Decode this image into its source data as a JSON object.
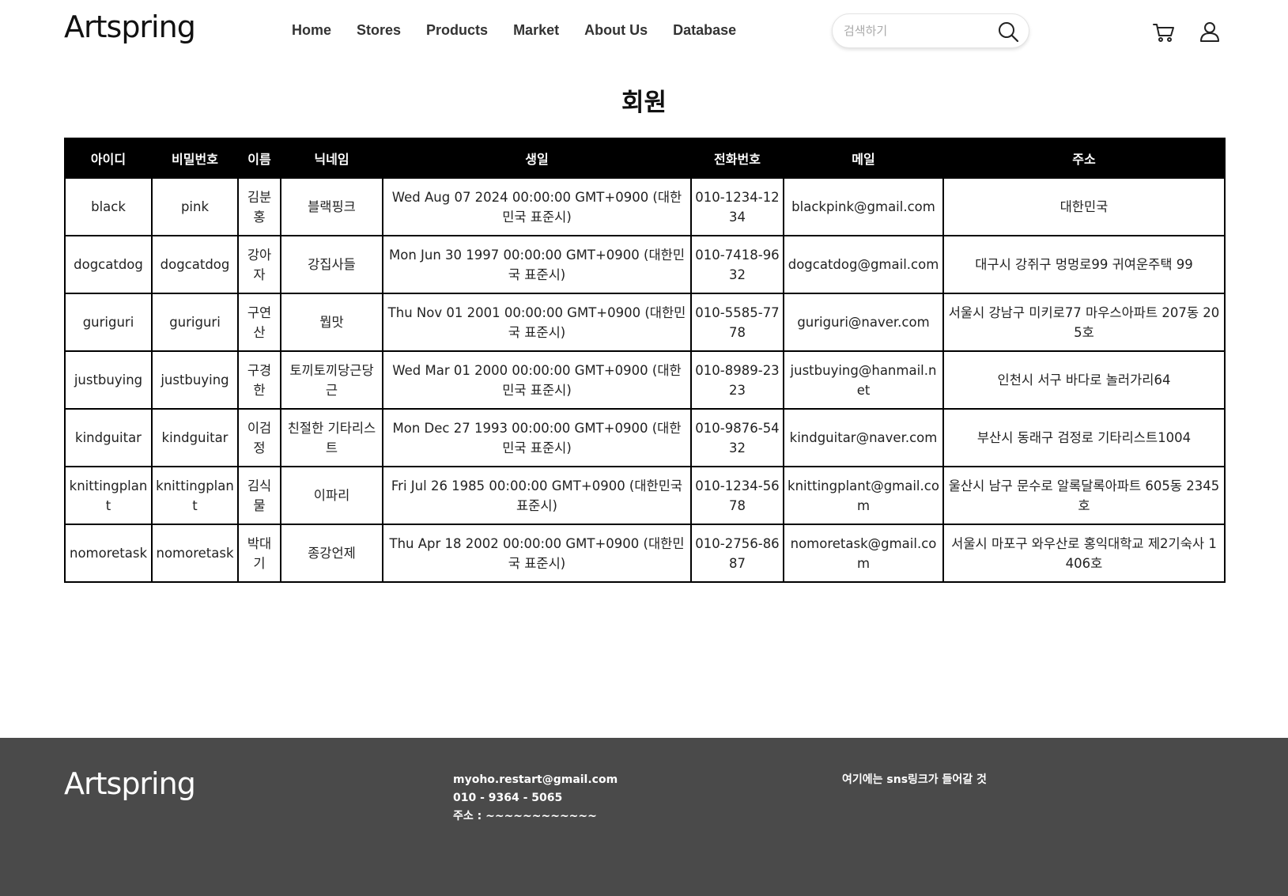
{
  "header": {
    "logo": "Artspring",
    "nav": [
      "Home",
      "Stores",
      "Products",
      "Market",
      "About Us",
      "Database"
    ],
    "search_placeholder": "검색하기",
    "search_icon": "search-icon",
    "cart_icon": "cart-icon",
    "user_icon": "user-icon"
  },
  "page": {
    "title": "회원"
  },
  "table": {
    "headers": [
      "아이디",
      "비밀번호",
      "이름",
      "닉네임",
      "생일",
      "전화번호",
      "메일",
      "주소"
    ],
    "rows": [
      [
        "black",
        "pink",
        "김분홍",
        "블랙핑크",
        "Wed Aug 07 2024 00:00:00 GMT+0900 (대한민국 표준시)",
        "010-1234-1234",
        "blackpink@gmail.com",
        "대한민국"
      ],
      [
        "dogcatdog",
        "dogcatdog",
        "강아자",
        "강집사들",
        "Mon Jun 30 1997 00:00:00 GMT+0900 (대한민국 표준시)",
        "010-7418-9632",
        "dogcatdog@gmail.com",
        "대구시 강쥐구 멍멍로99 귀여운주택 99"
      ],
      [
        "guriguri",
        "guriguri",
        "구연산",
        "뭡맛",
        "Thu Nov 01 2001 00:00:00 GMT+0900 (대한민국 표준시)",
        "010-5585-7778",
        "guriguri@naver.com",
        "서울시 강남구 미키로77 마우스아파트 207동 205호"
      ],
      [
        "justbuying",
        "justbuying",
        "구경한",
        "토끼토끼당근당근",
        "Wed Mar 01 2000 00:00:00 GMT+0900 (대한민국 표준시)",
        "010-8989-2323",
        "justbuying@hanmail.net",
        "인천시 서구 바다로 놀러가리64"
      ],
      [
        "kindguitar",
        "kindguitar",
        "이검정",
        "친절한 기타리스트",
        "Mon Dec 27 1993 00:00:00 GMT+0900 (대한민국 표준시)",
        "010-9876-5432",
        "kindguitar@naver.com",
        "부산시 동래구 검정로 기타리스트1004"
      ],
      [
        "knittingplant",
        "knittingplant",
        "김식물",
        "이파리",
        "Fri Jul 26 1985 00:00:00 GMT+0900 (대한민국 표준시)",
        "010-1234-5678",
        "knittingplant@gmail.com",
        "울산시 남구 문수로 알록달록아파트 605동 2345호"
      ],
      [
        "nomoretask",
        "nomoretask",
        "박대기",
        "종강언제",
        "Thu Apr 18 2002 00:00:00 GMT+0900 (대한민국 표준시)",
        "010-2756-8687",
        "nomoretask@gmail.com",
        "서울시 마포구 와우산로 홍익대학교 제2기숙사 1406호"
      ]
    ]
  },
  "footer": {
    "logo": "Artspring",
    "email": "myoho.restart@gmail.com",
    "phone": "010 - 9364 - 5065",
    "address": "주소 : ~~~~~~~~~~~~",
    "sns": "여기에는 sns링크가 들어갈 것"
  }
}
